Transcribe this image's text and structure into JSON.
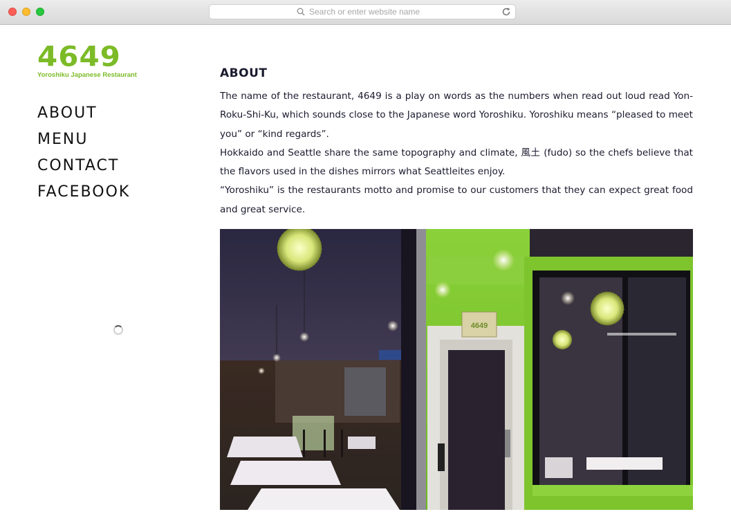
{
  "browser": {
    "url_placeholder": "Search or enter website name"
  },
  "logo": {
    "mark": "4649",
    "subtitle": "Yoroshiku Japanese Restaurant",
    "color": "#7cbb27"
  },
  "nav": {
    "items": [
      {
        "label": "ABOUT"
      },
      {
        "label": "MENU"
      },
      {
        "label": "CONTACT"
      },
      {
        "label": "FACEBOOK"
      }
    ]
  },
  "main": {
    "title": "ABOUT",
    "paragraphs": [
      "The name of the restaurant, 4649 is a play on words as the numbers when read out loud read Yon-Roku-Shi-Ku, which sounds close to the Japanese word Yoroshiku. Yoroshiku means “pleased to meet you” or “kind regards”.",
      "Hokkaido and Seattle share the same topography and climate, 風土 (fudo) so the chefs believe that the flavors used in the dishes mirrors what Seattleites enjoy.",
      "“Yoroshiku” is the restaurants motto and promise to our customers that they can expect great food and great service."
    ],
    "photo": {
      "sign_text": "4649"
    }
  },
  "icons": {
    "search": "search-icon",
    "reload": "reload-icon",
    "loading": "loading-spinner-icon"
  }
}
